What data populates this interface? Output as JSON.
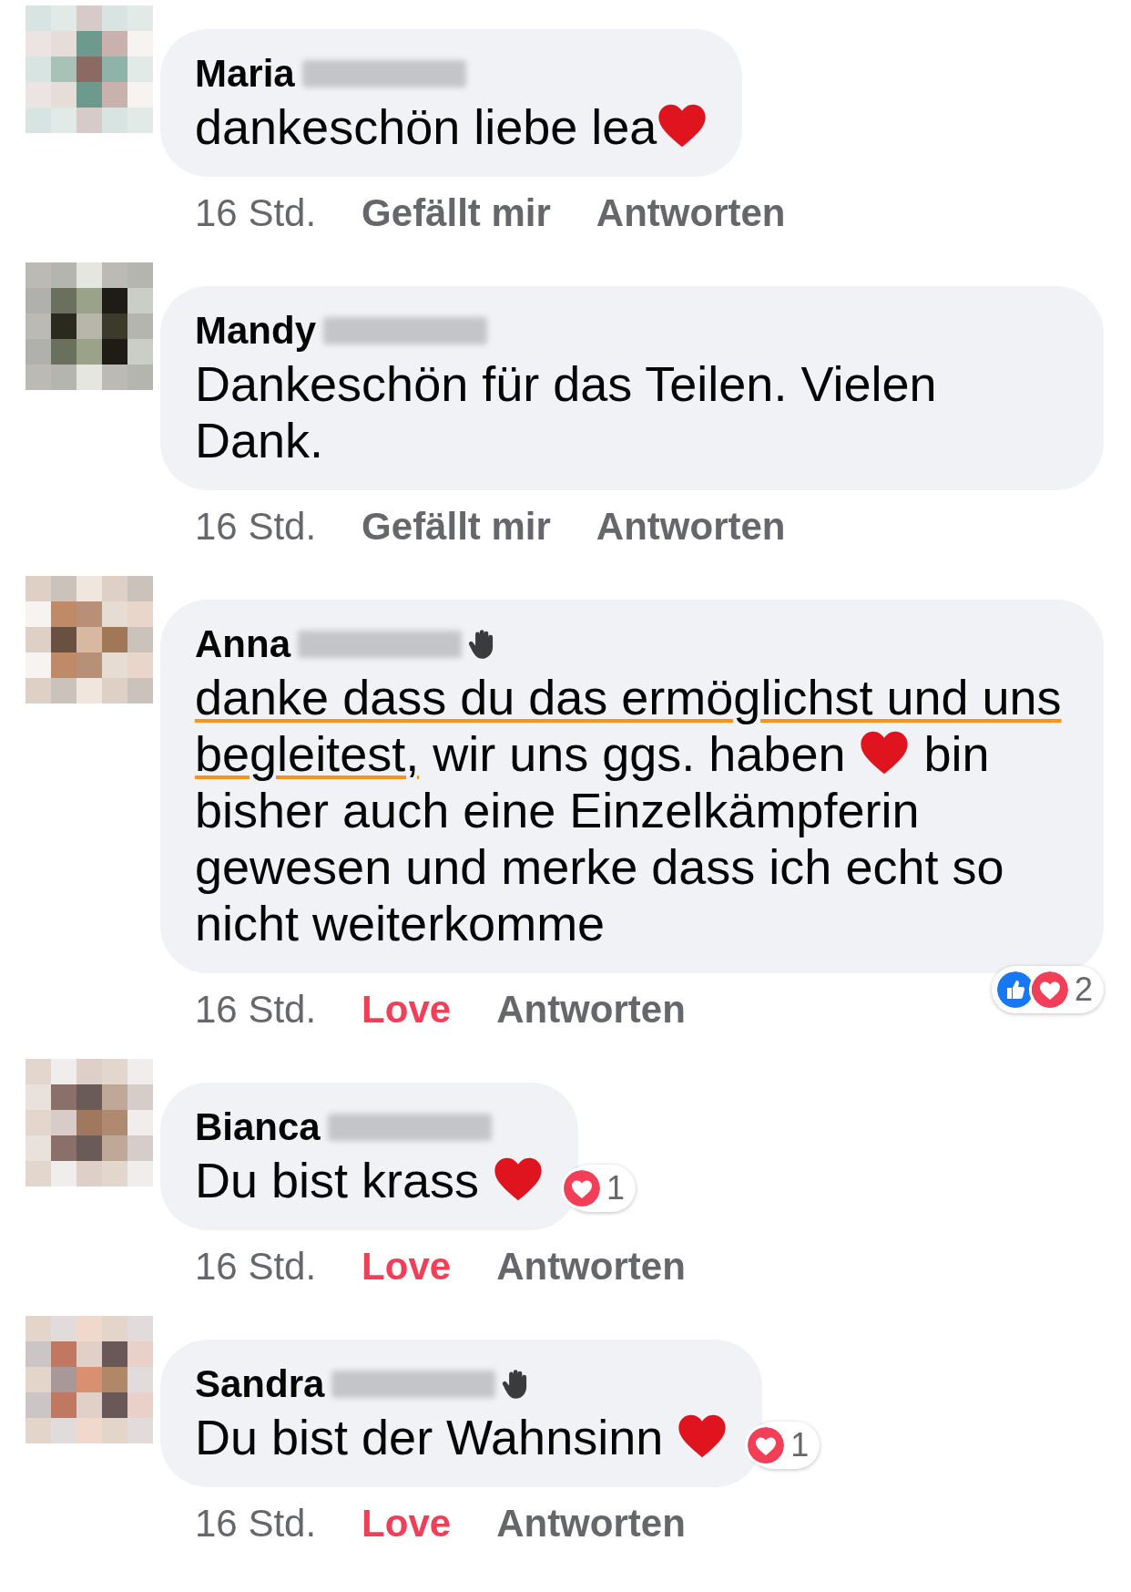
{
  "comments": [
    {
      "name": "Maria",
      "wave": false,
      "parts": [
        {
          "kind": "text",
          "text": "dankeschön liebe lea",
          "underlined": false
        },
        {
          "kind": "heart"
        }
      ],
      "time": "16 Std.",
      "reaction": {
        "label": "Gefällt mir",
        "selected": false
      },
      "reply": "Antworten"
    },
    {
      "name": "Mandy",
      "wave": false,
      "parts": [
        {
          "kind": "text",
          "text": "Dankeschön für das Teilen. Vielen Dank.",
          "underlined": false
        }
      ],
      "time": "16 Std.",
      "reaction": {
        "label": "Gefällt mir",
        "selected": false
      },
      "reply": "Antworten"
    },
    {
      "name": "Anna",
      "wave": true,
      "parts": [
        {
          "kind": "text",
          "text": "danke dass du das ermöglichst und uns begleitest,",
          "underlined": true
        },
        {
          "kind": "text",
          "text": " wir uns ggs. haben ",
          "underlined": false
        },
        {
          "kind": "heart"
        },
        {
          "kind": "text",
          "text": " bin bisher auch eine Einzelkämpferin gewesen und merke dass ich echt so nicht weiterkomme",
          "underlined": false
        }
      ],
      "time": "16 Std.",
      "reaction": {
        "label": "Love",
        "selected": true
      },
      "reply": "Antworten",
      "summary": {
        "kind": "corner",
        "icons": [
          {
            "kind": "like"
          },
          {
            "kind": "love"
          }
        ],
        "count": "2"
      }
    },
    {
      "name": "Bianca",
      "wave": false,
      "parts": [
        {
          "kind": "text",
          "text": "Du bist krass ",
          "underlined": false
        },
        {
          "kind": "heart"
        }
      ],
      "time": "16 Std.",
      "reaction": {
        "label": "Love",
        "selected": true
      },
      "reply": "Antworten",
      "summary": {
        "kind": "inline",
        "icons": [
          {
            "kind": "love"
          }
        ],
        "count": "1"
      }
    },
    {
      "name": "Sandra",
      "wave": true,
      "parts": [
        {
          "kind": "text",
          "text": "Du bist der Wahnsinn ",
          "underlined": false
        },
        {
          "kind": "heart"
        }
      ],
      "time": "16 Std.",
      "reaction": {
        "label": "Love",
        "selected": true
      },
      "reply": "Antworten",
      "summary": {
        "kind": "inline",
        "icons": [
          {
            "kind": "love"
          }
        ],
        "count": "1"
      }
    }
  ]
}
